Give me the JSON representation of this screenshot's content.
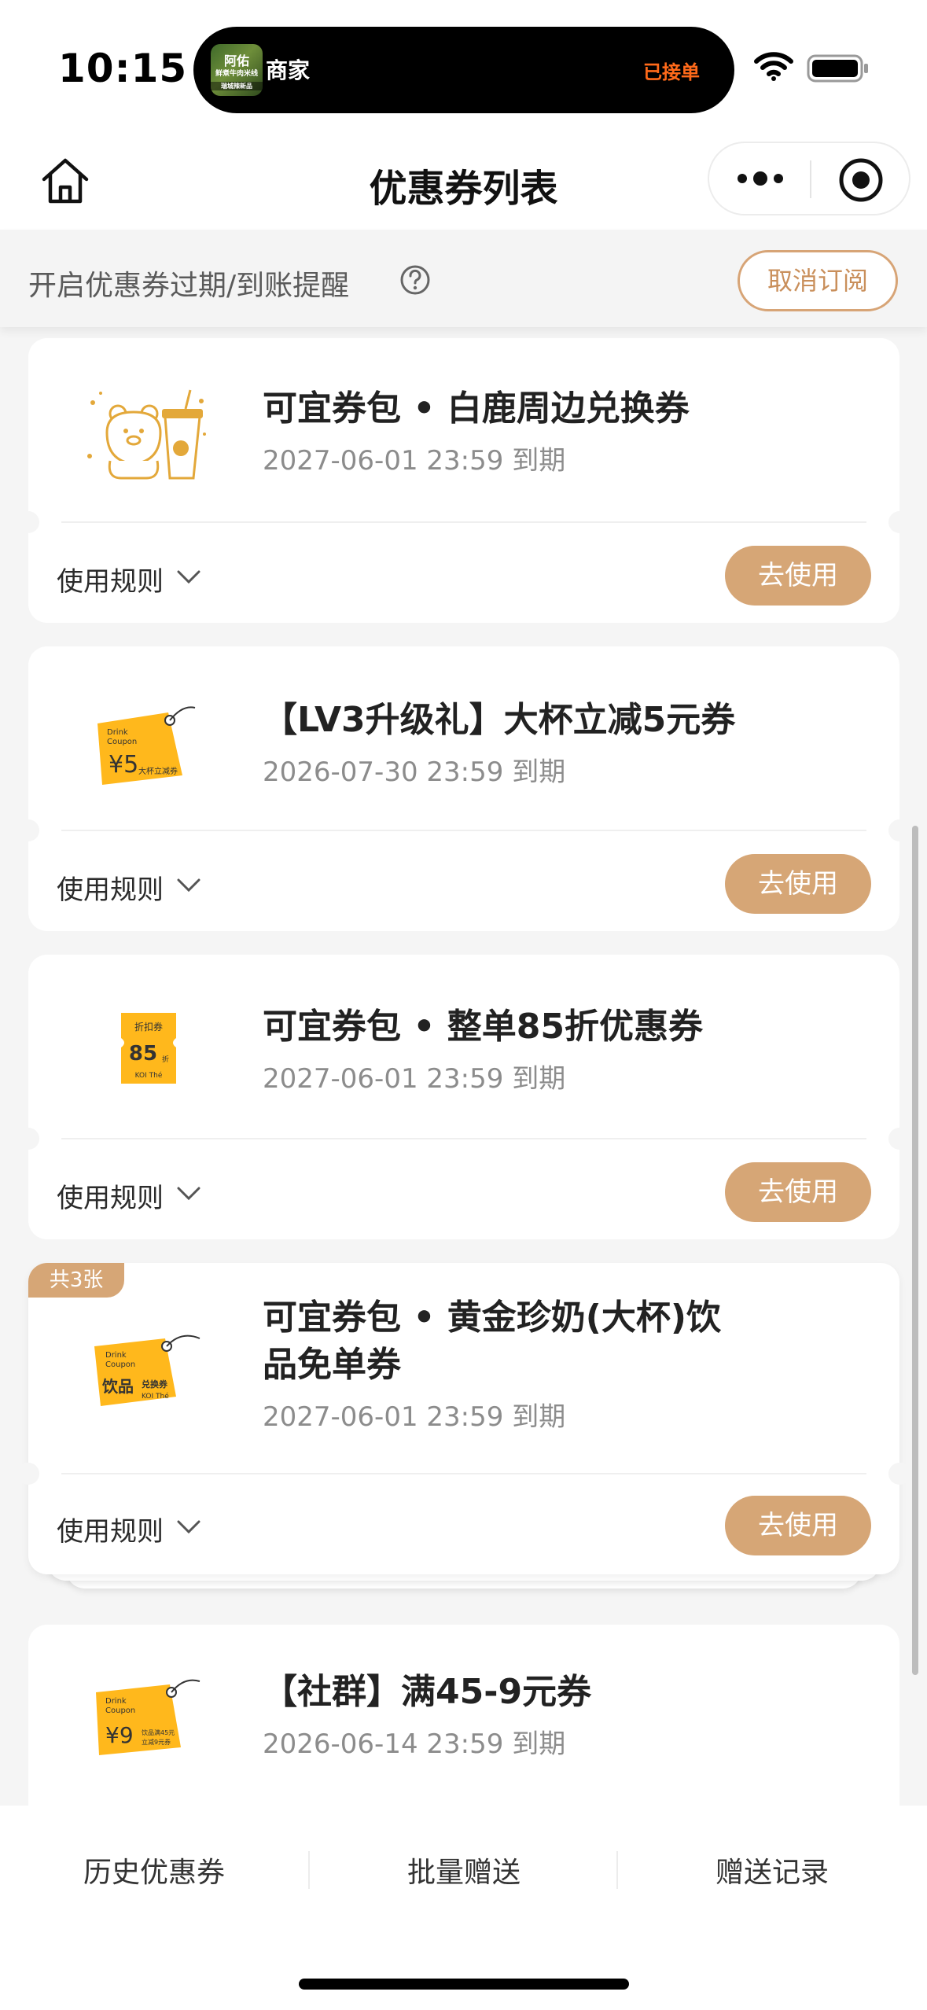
{
  "status_bar": {
    "time": "10:15",
    "activity": {
      "thumb_lines": [
        "阿佑",
        "鲜煮牛肉米线",
        "瑞城辣新品"
      ],
      "title": "商家",
      "status": "已接单"
    },
    "icons": [
      "wifi-icon",
      "battery-icon"
    ]
  },
  "nav": {
    "title": "优惠券列表",
    "icons": [
      "home-icon",
      "more-icon",
      "target-icon"
    ]
  },
  "reminder": {
    "text": "开启优惠券过期/到账提醒",
    "unsubscribe_label": "取消订阅"
  },
  "coupons": [
    {
      "title_lines": [
        "可宜券包 • 白鹿周边兑换券"
      ],
      "expire": "2027-06-01 23:59 到期",
      "rules_label": "使用规则",
      "use_label": "去使用"
    },
    {
      "title_lines": [
        "【LV3升级礼】大杯立减5元券"
      ],
      "expire": "2026-07-30 23:59 到期",
      "rules_label": "使用规则",
      "use_label": "去使用",
      "image_text": [
        "Drink",
        "Coupon",
        "¥5",
        "大杯立减券"
      ]
    },
    {
      "title_lines": [
        "可宜券包 • 整单85折优惠券"
      ],
      "expire": "2027-06-01 23:59 到期",
      "rules_label": "使用规则",
      "use_label": "去使用",
      "image_text": [
        "折扣券",
        "85",
        "折",
        "KOI Thé"
      ]
    },
    {
      "badge": "共3张",
      "title_lines": [
        "可宜券包 • 黄金珍奶(大杯)饮",
        "品免单券"
      ],
      "expire": "2027-06-01 23:59 到期",
      "rules_label": "使用规则",
      "use_label": "去使用",
      "image_text": [
        "Drink",
        "Coupon",
        "饮品",
        "兑换券",
        "KOI Thé"
      ]
    },
    {
      "title_lines": [
        "【社群】满45-9元券"
      ],
      "expire": "2026-06-14 23:59 到期",
      "image_text": [
        "Drink",
        "Coupon",
        "¥9",
        "饮品满45元",
        "立减9元券"
      ]
    }
  ],
  "bottom_bar": {
    "tabs": [
      "历史优惠券",
      "批量赠送",
      "赠送记录"
    ]
  },
  "colors": {
    "accent": "#d6a676",
    "accent_text": "#c98f5b",
    "coupon_yellow": "#ffb81c",
    "activity_status": "#ff6a1a",
    "page_bg": "#f5f5f5"
  }
}
